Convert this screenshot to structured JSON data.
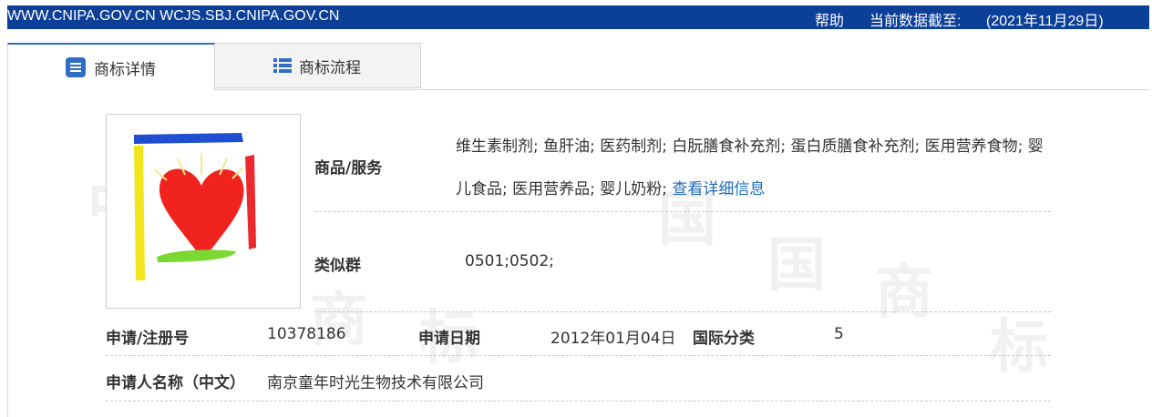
{
  "topbar": {
    "domains": "WWW.CNIPA.GOV.CN WCJS.SBJ.CNIPA.GOV.CN",
    "help": "帮助",
    "date_label": "当前数据截至:",
    "date_value": "(2021年11月29日)"
  },
  "tabs": [
    {
      "label": "商标详情",
      "icon": "document-list-icon",
      "active": true
    },
    {
      "label": "商标流程",
      "icon": "list-icon",
      "active": false
    }
  ],
  "watermark": [
    "中",
    "国",
    "商",
    "标",
    "中",
    "国",
    "商",
    "标"
  ],
  "details": {
    "goods_label": "商品/服务",
    "goods_line1": "维生素制剂; 鱼肝油; 医药制剂; 白朊膳食补充剂; 蛋白质膳食补充剂; 医用营养食物; 婴",
    "goods_line2": "儿食品; 医用营养品; 婴儿奶粉; ",
    "goods_more_link": "查看详细信息",
    "similar_group_label": "类似群",
    "similar_group_value": "0501;0502;",
    "reg_no_label": "申请/注册号",
    "reg_no_value": "10378186",
    "apply_date_label": "申请日期",
    "apply_date_value": "2012年01月04日",
    "intl_class_label": "国际分类",
    "intl_class_value": "5",
    "applicant_label": "申请人名称（中文）",
    "applicant_value": "南京童年时光生物技术有限公司"
  },
  "colors": {
    "topbar": "#0c3f97",
    "tab_accent": "#2f6ec2",
    "link": "#1f6bb5"
  }
}
